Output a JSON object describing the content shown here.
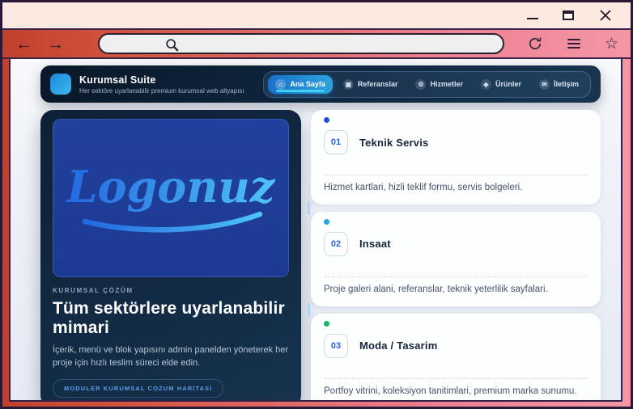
{
  "window": {
    "controls": {
      "minimize": "minimize",
      "maximize": "maximize",
      "close": "close"
    }
  },
  "browser": {
    "url_value": "",
    "url_placeholder": "",
    "icons": {
      "back": "←",
      "forward": "→",
      "favorite": "☆"
    }
  },
  "site": {
    "brand": {
      "name": "Kurumsal Suite",
      "tagline": "Her sektöre uyarlanabilir premium kurumsal web altyapısı"
    },
    "nav": [
      {
        "label": "Ana Sayfa",
        "glyph": "⌂",
        "active": true
      },
      {
        "label": "Referanslar",
        "glyph": "▣",
        "active": false
      },
      {
        "label": "Hizmetler",
        "glyph": "⚙",
        "active": false
      },
      {
        "label": "Ürünler",
        "glyph": "◈",
        "active": false
      },
      {
        "label": "İletişim",
        "glyph": "✉",
        "active": false
      }
    ],
    "hero": {
      "logo_text": "Logonuz",
      "eyebrow": "KURUMSAL ÇÖZÜM",
      "heading": "Tüm sektörlere uyarlanabilir mimari",
      "description": "İçerik, menü ve blok yapısını admin panelden yöneterek her proje için hızlı teslim süreci elde edin.",
      "cta_label": "MODULER KURUMSAL COZUM HARİTASİ"
    },
    "sectors": [
      {
        "number": "01",
        "title": "Teknik Servis",
        "description": "Hizmet kartlari, hizli teklif formu, servis bolgeleri.",
        "dot_color": "#2352d6"
      },
      {
        "number": "02",
        "title": "Insaat",
        "description": "Proje galeri alani, referanslar, teknik yeterlilik sayfalari.",
        "dot_color": "#23a7d6"
      },
      {
        "number": "03",
        "title": "Moda / Tasarim",
        "description": "Portfoy vitrini, koleksiyon tanitimlari, premium marka sunumu.",
        "dot_color": "#1cb36b"
      }
    ]
  },
  "colors": {
    "frame_left": "#c2402e",
    "frame_right": "#f496a5",
    "titlebar_bg": "#fce9e0",
    "frame_border": "#2a1838",
    "header_navy": "#102740",
    "accent_blue": "#2563eb",
    "active_pill_start": "#1a72ca",
    "active_pill_end": "#2ea2dd",
    "active_underline": "#3fd2f0",
    "logo_panel_blue": "#1e3c96",
    "logo_gradient_start": "#2368e0",
    "logo_gradient_end": "#4fc3f7"
  }
}
